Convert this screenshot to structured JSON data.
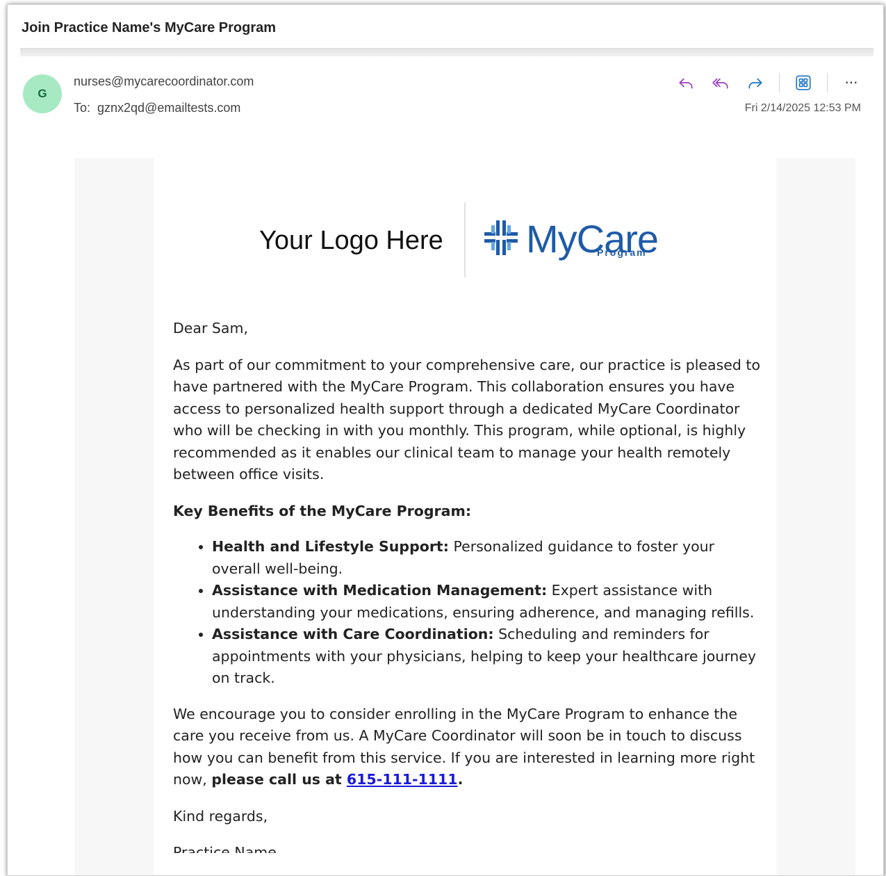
{
  "email": {
    "subject": "Join Practice Name's MyCare Program",
    "avatar_initial": "G",
    "sender": "nurses@mycarecoordinator.com",
    "to_label": "To:",
    "to_address": "gznx2qd@emailtests.com",
    "date": "Fri 2/14/2025 12:53 PM"
  },
  "actions": {
    "reply_icon": "reply-icon",
    "reply_all_icon": "reply-all-icon",
    "forward_icon": "forward-icon",
    "apps_icon": "apps-icon",
    "more_icon": "more-icon",
    "more_glyph": "···",
    "accent_color": "#9b3fbf"
  },
  "logos": {
    "placeholder": "Your Logo Here",
    "brand_word": "MyCare",
    "brand_sub": "Program",
    "brand_color": "#1e5ba8"
  },
  "body": {
    "greeting": "Dear Sam,",
    "paragraph1": "As part of our commitment to your comprehensive care, our practice is pleased to have partnered with the MyCare Program. This collaboration ensures you have access to personalized health support through a dedicated MyCare Coordinator who will be checking in with you monthly. This program, while optional, is highly recommended as it enables our clinical team to manage your health remotely between office visits.",
    "benefits_heading": "Key Benefits of the MyCare Program:",
    "benefits": [
      {
        "title": "Health and Lifestyle Support:",
        "text": " Personalized guidance to foster your overall well-being."
      },
      {
        "title": "Assistance with Medication Management:",
        "text": " Expert assistance with understanding your medications, ensuring adherence, and managing refills."
      },
      {
        "title": "Assistance with Care Coordination:",
        "text": " Scheduling and reminders for appointments with your physicians, helping to keep your healthcare journey on track."
      }
    ],
    "paragraph2": "We encourage you to consider enrolling in the MyCare Program to enhance the care you receive from us. A MyCare Coordinator will soon be in touch to discuss how you can benefit from this service. If you are interested in learning more right now, ",
    "call_text": "please call us at ",
    "phone": "615-111-1111",
    "period": ".",
    "closing": "Kind regards,",
    "signature_partial": "Practice Name"
  }
}
